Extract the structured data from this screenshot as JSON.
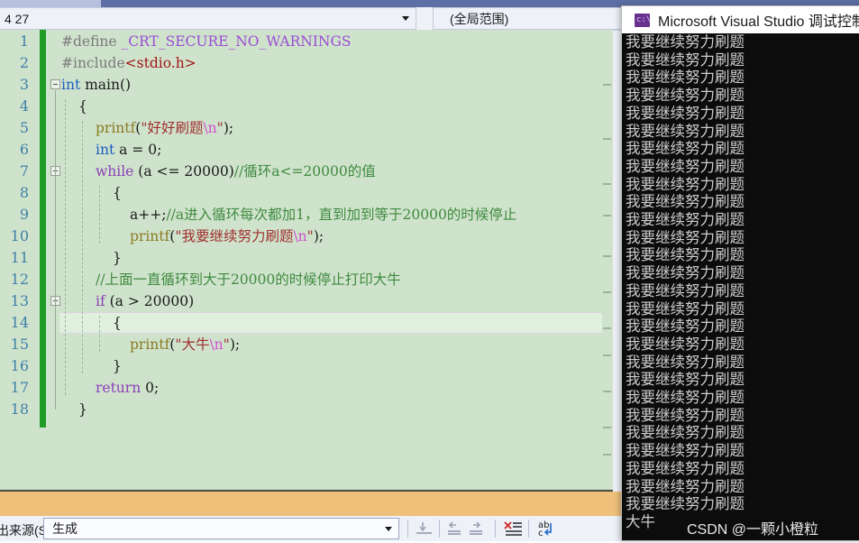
{
  "navbar": {
    "scope_left": "4 27",
    "scope_right": "(全局范围)"
  },
  "editor": {
    "line_count": 18,
    "current_line": 14,
    "lines": [
      {
        "n": 1,
        "tokens": [
          {
            "t": "#define ",
            "c": "c-pre"
          },
          {
            "t": "_CRT_SECURE_NO_WARNINGS",
            "c": "c-macro"
          }
        ]
      },
      {
        "n": 2,
        "tokens": [
          {
            "t": "#include",
            "c": "c-pre"
          },
          {
            "t": "<stdio.h>",
            "c": "c-ang"
          }
        ]
      },
      {
        "n": 3,
        "tokens": [
          {
            "t": "int",
            "c": "c-key"
          },
          {
            "t": " main()",
            "c": "c-plain"
          }
        ]
      },
      {
        "n": 4,
        "tokens": [
          {
            "t": "{",
            "c": "c-plain"
          }
        ],
        "indent": 1
      },
      {
        "n": 5,
        "tokens": [
          {
            "t": "printf",
            "c": "c-fn"
          },
          {
            "t": "(",
            "c": "c-plain"
          },
          {
            "t": "\"好好刷题",
            "c": "c-str"
          },
          {
            "t": "\\n",
            "c": "c-esc"
          },
          {
            "t": "\"",
            "c": "c-str"
          },
          {
            "t": ");",
            "c": "c-plain"
          }
        ],
        "indent": 2
      },
      {
        "n": 6,
        "tokens": [
          {
            "t": "int",
            "c": "c-key"
          },
          {
            "t": " a = ",
            "c": "c-plain"
          },
          {
            "t": "0",
            "c": "c-num"
          },
          {
            "t": ";",
            "c": "c-plain"
          }
        ],
        "indent": 2
      },
      {
        "n": 7,
        "tokens": [
          {
            "t": "while",
            "c": "c-kw2"
          },
          {
            "t": " (a <= ",
            "c": "c-plain"
          },
          {
            "t": "20000",
            "c": "c-num"
          },
          {
            "t": ")",
            "c": "c-plain"
          },
          {
            "t": "//循环a<=20000的值",
            "c": "c-com"
          }
        ],
        "indent": 2
      },
      {
        "n": 8,
        "tokens": [
          {
            "t": "{",
            "c": "c-plain"
          }
        ],
        "indent": 3
      },
      {
        "n": 9,
        "tokens": [
          {
            "t": "a++;",
            "c": "c-plain"
          },
          {
            "t": "//a进入循环每次都加1，直到加到等于20000的时候停止",
            "c": "c-com"
          }
        ],
        "indent": 4
      },
      {
        "n": 10,
        "tokens": [
          {
            "t": "printf",
            "c": "c-fn"
          },
          {
            "t": "(",
            "c": "c-plain"
          },
          {
            "t": "\"我要继续努力刷题",
            "c": "c-str"
          },
          {
            "t": "\\n",
            "c": "c-esc"
          },
          {
            "t": "\"",
            "c": "c-str"
          },
          {
            "t": ");",
            "c": "c-plain"
          }
        ],
        "indent": 4
      },
      {
        "n": 11,
        "tokens": [
          {
            "t": "}",
            "c": "c-plain"
          }
        ],
        "indent": 3
      },
      {
        "n": 12,
        "tokens": [
          {
            "t": "//上面一直循环到大于20000的时候停止打印大牛",
            "c": "c-com"
          }
        ],
        "indent": 2
      },
      {
        "n": 13,
        "tokens": [
          {
            "t": "if",
            "c": "c-kw2"
          },
          {
            "t": " (a > ",
            "c": "c-plain"
          },
          {
            "t": "20000",
            "c": "c-num"
          },
          {
            "t": ")",
            "c": "c-plain"
          }
        ],
        "indent": 2
      },
      {
        "n": 14,
        "tokens": [
          {
            "t": "{",
            "c": "c-plain"
          }
        ],
        "indent": 3
      },
      {
        "n": 15,
        "tokens": [
          {
            "t": "printf",
            "c": "c-fn"
          },
          {
            "t": "(",
            "c": "c-plain"
          },
          {
            "t": "\"大牛",
            "c": "c-str"
          },
          {
            "t": "\\n",
            "c": "c-esc"
          },
          {
            "t": "\"",
            "c": "c-str"
          },
          {
            "t": ");",
            "c": "c-plain"
          }
        ],
        "indent": 4
      },
      {
        "n": 16,
        "tokens": [
          {
            "t": "}",
            "c": "c-plain"
          }
        ],
        "indent": 3
      },
      {
        "n": 17,
        "tokens": [
          {
            "t": "return",
            "c": "c-kw2"
          },
          {
            "t": " ",
            "c": "c-plain"
          },
          {
            "t": "0",
            "c": "c-num"
          },
          {
            "t": ";",
            "c": "c-plain"
          }
        ],
        "indent": 2
      },
      {
        "n": 18,
        "tokens": [
          {
            "t": "}",
            "c": "c-plain"
          }
        ],
        "indent": 1
      }
    ],
    "fold_lines": [
      3,
      7,
      13
    ],
    "colors": {
      "background": "#cfe3cc",
      "change_bar_saved": "#1e9c26",
      "current_line_highlight": "#dff0dc",
      "line_number": "#3f7fa8"
    }
  },
  "output_pane": {
    "label": "出来源(S):",
    "selected_source": "生成",
    "buttons": [
      {
        "name": "go-to-line-icon",
        "title": ""
      },
      {
        "name": "navigate-back-icon",
        "title": ""
      },
      {
        "name": "navigate-forward-icon",
        "title": ""
      },
      {
        "name": "clear-all-icon",
        "title": ""
      },
      {
        "name": "toggle-word-wrap-icon",
        "title": ""
      }
    ]
  },
  "console": {
    "title": "Microsoft Visual Studio 调试控制台",
    "icon": "console-app-icon",
    "repeat_text": "我要继续努力刷题",
    "repeat_count": 27,
    "final_line": "大牛",
    "watermark": "CSDN @一颗小橙粒",
    "colors": {
      "background": "#0c0c0c",
      "text": "#cccccc",
      "titlebar": "#ffffff"
    }
  }
}
